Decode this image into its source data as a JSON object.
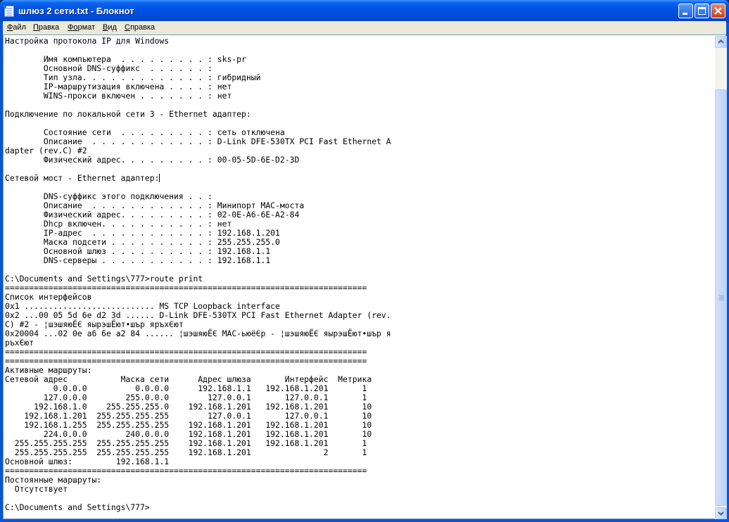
{
  "window": {
    "title": "шлюз 2 сети.txt - Блокнот"
  },
  "menu": {
    "items": [
      {
        "key": "Ф",
        "rest": "айл"
      },
      {
        "key": "П",
        "rest": "равка"
      },
      {
        "key": "Фо",
        "rest": "рмат"
      },
      {
        "key": "В",
        "rest": "ид"
      },
      {
        "key": "С",
        "rest": "правка"
      }
    ]
  },
  "icons": {
    "app": "notepad-icon",
    "minimize": "minimize-icon",
    "maximize": "maximize-icon",
    "close": "close-icon"
  },
  "document": {
    "before_caret": "Настройка протокола IP для Windows\n\n        Имя компьютера  . . . . . . . . . : sks-pr\n        Основной DNS-суффикс  . . . . . . :\n        Тип узла. . . . . . . . . . . . . : гибридный\n        IP-маршрутизация включена . . . . : нет\n        WINS-прокси включен . . . . . . . : нет\n\nПодключение по локальной сети 3 - Ethernet адаптер:\n\n        Состояние сети  . . . . . . . . . : сеть отключена\n        Описание  . . . . . . . . . . . . : D-Link DFE-530TX PCI Fast Ethernet A\ndapter (rev.C) #2\n        Физический адрес. . . . . . . . . : 00-05-5D-6E-D2-3D\n\nСетевой мост - Ethernet адаптер:",
    "after_caret": "\n\n        DNS-суффикс этого подключения . . :\n        Описание  . . . . . . . . . . . . : Минипорт MAC-моста\n        Физический адрес. . . . . . . . . : 02-0E-A6-6E-A2-84\n        Dhcp включен. . . . . . . . . . . : нет\n        IP-адрес  . . . . . . . . . . . . : 192.168.1.201\n        Маска подсети . . . . . . . . . . : 255.255.255.0\n        Основной шлюз . . . . . . . . . . : 192.168.1.1\n        DNS-серверы . . . . . . . . . . . : 192.168.1.1\n\nC:\\Documents and Settings\\777>route print\n===========================================================================\nСписок интерфейсов\n0x1 ........................... MS TCP Loopback interface\n0x2 ...00 05 5d 6e d2 3d ...... D-Link DFE-530TX PCI Fast Ethernet Adapter (rev.\nC) #2 - ¦шэшяюЁЄ яырэшЁют•шър яръхЄют\n0x20004 ...02 0e a6 6e a2 84 ...... ¦шэшяюЁЄ MAC-ьюёЄр - ¦шэшяюЁЄ яырэшЁют•шър я\nръхЄют\n===========================================================================\n===========================================================================\nАктивные маршруты:\nСетевой адрес           Маска сети      Адрес шлюза       Интерфейс  Метрика\n          0.0.0.0          0.0.0.0      192.168.1.1   192.168.1.201       1\n        127.0.0.0        255.0.0.0        127.0.0.1       127.0.0.1       1\n      192.168.1.0    255.255.255.0    192.168.1.201   192.168.1.201       10\n    192.168.1.201  255.255.255.255        127.0.0.1       127.0.0.1       10\n    192.168.1.255  255.255.255.255    192.168.1.201   192.168.1.201       10\n        224.0.0.0        240.0.0.0    192.168.1.201   192.168.1.201       10\n  255.255.255.255  255.255.255.255    192.168.1.201   192.168.1.201       1\n  255.255.255.255  255.255.255.255    192.168.1.201               2       1\nОсновной шлюз:         192.168.1.1\n===========================================================================\nПостоянные маршруты:\n  Отсутствует\n\nC:\\Documents and Settings\\777>"
  }
}
